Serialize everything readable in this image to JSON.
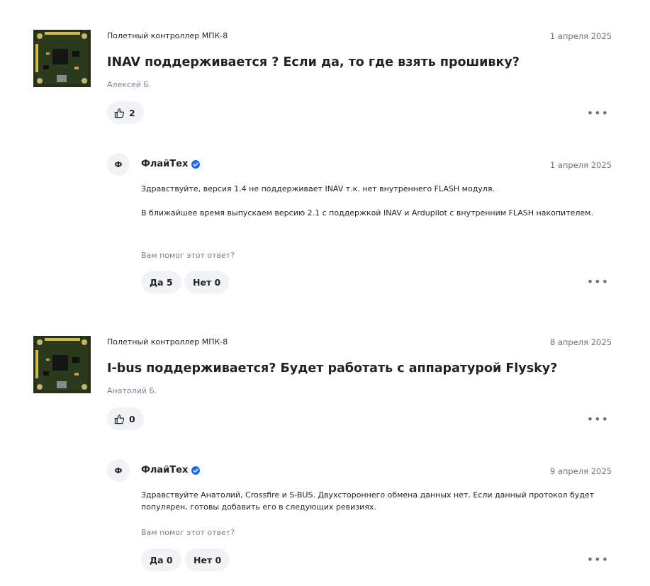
{
  "questions": [
    {
      "product": "Полетный контроллер МПК-8",
      "date": "1 апреля 2025",
      "title": "INAV поддерживается ? Если да, то где взять прошивку?",
      "author": "Алексей Б.",
      "likes": "2",
      "answer": {
        "avatar_letter": "Ф",
        "name": "ФлайТех",
        "date": "1 апреля 2025",
        "paragraphs": [
          "Здравствуйте, версия 1.4 не поддерживает INAV т.к. нет внутреннего FLASH модуля.",
          "В ближайшее время выпускаем версию 2.1 с поддержкой INAV и Ardupilot с внутренним FLASH накопителем."
        ],
        "helpful_prompt": "Вам помог этот ответ?",
        "yes_label": "Да 5",
        "no_label": "Нет 0"
      }
    },
    {
      "product": "Полетный контроллер МПК-8",
      "date": "8 апреля 2025",
      "title": "I-bus поддерживается? Будет работать с аппаратурой Flysky?",
      "author": "Анатолий Б.",
      "likes": "0",
      "answer": {
        "avatar_letter": "Ф",
        "name": "ФлайТех",
        "date": "9 апреля 2025",
        "paragraphs": [
          "Здравствуйте Анатолий, Crossfire и S-BUS. Двухстороннего обмена данных нет. Если данный протокол будет популярен, готовы добавить его в следующих ревизиях."
        ],
        "helpful_prompt": "Вам помог этот ответ?",
        "yes_label": "Да 0",
        "no_label": "Нет 0"
      }
    }
  ],
  "icons": {
    "like": "thumbs-up-icon",
    "verified": "verified-check-icon",
    "more": "more-dots-icon"
  },
  "colors": {
    "verified": "#1a6cf0",
    "pill_bg": "#f2f3f7",
    "muted_text": "#6d7383"
  }
}
